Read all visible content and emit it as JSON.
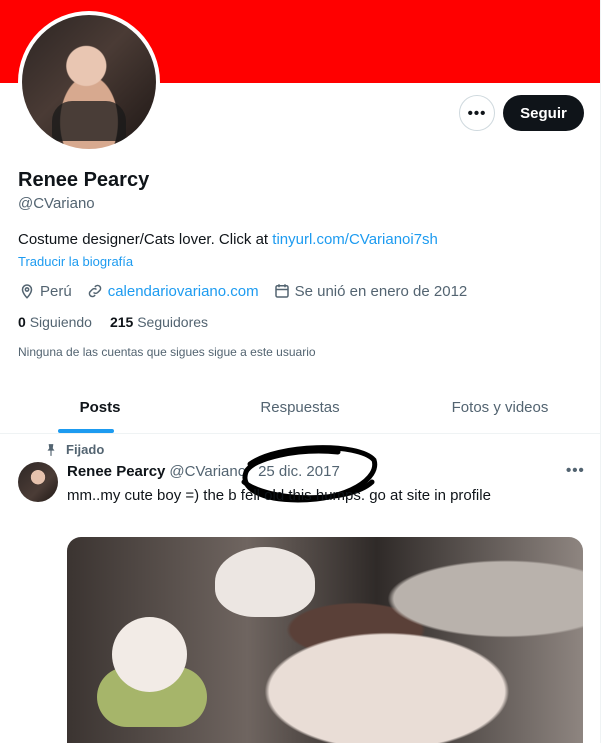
{
  "profile": {
    "name": "Renee Pearcy",
    "handle": "@CVariano",
    "bio_text": "Costume designer/Cats lover. Click at ",
    "bio_link": "tinyurl.com/CVarianoi7sh",
    "translate_label": "Traducir la biografía",
    "location": "Perú",
    "website": "calendariovariano.com",
    "joined": "Se unió en enero de 2012",
    "following_count": "0",
    "following_label": "Siguiendo",
    "followers_count": "215",
    "followers_label": "Seguidores",
    "followers_note": "Ninguna de las cuentas que sigues sigue a este usuario"
  },
  "actions": {
    "more_label": "•••",
    "follow_label": "Seguir"
  },
  "tabs": [
    {
      "label": "Posts",
      "active": true
    },
    {
      "label": "Respuestas",
      "active": false
    },
    {
      "label": "Fotos y videos",
      "active": false
    }
  ],
  "post": {
    "pinned_label": "Fijado",
    "name": "Renee Pearcy",
    "handle": "@CVariano",
    "date": "25 dic. 2017",
    "more_label": "•••",
    "text": "mm..my cute boy =) the b       fell       old this humps. go at site in profile"
  },
  "colors": {
    "banner": "#ff0000",
    "accent": "#1d9bf0",
    "text": "#0f1419",
    "secondary": "#536471"
  },
  "icons": {
    "location": "map-pin-icon",
    "website": "link-icon",
    "joined": "calendar-icon",
    "pinned": "pin-icon"
  }
}
